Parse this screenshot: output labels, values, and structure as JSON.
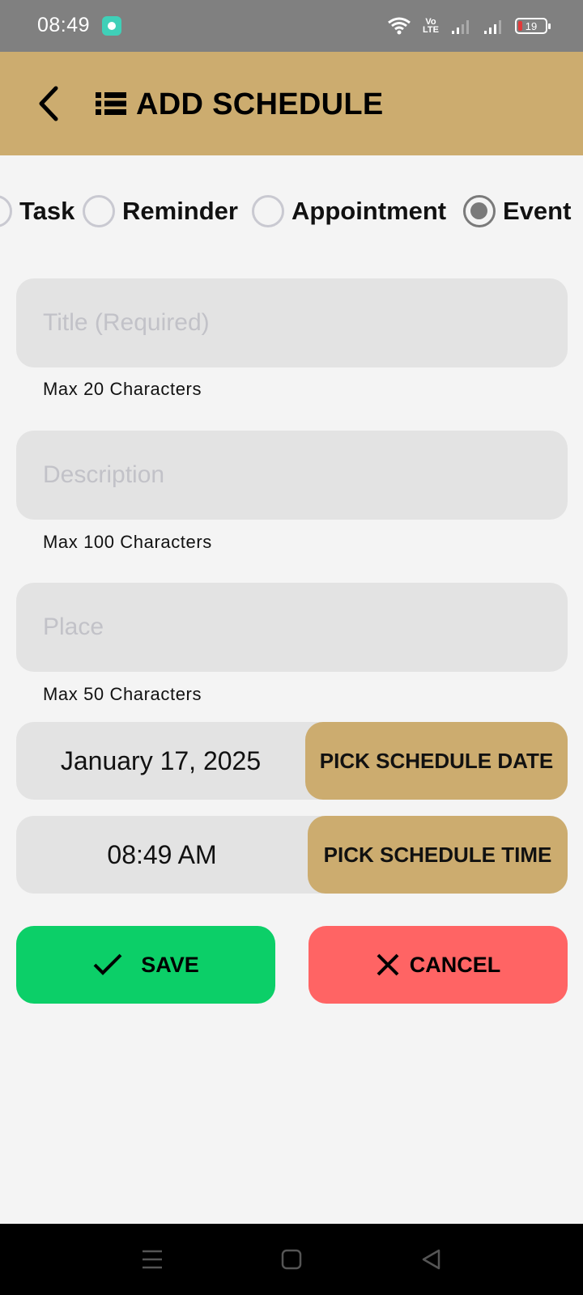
{
  "status_bar": {
    "time": "08:49",
    "network_label": "Vo LTE",
    "battery_level": "19"
  },
  "header": {
    "title": "ADD SCHEDULE"
  },
  "schedule_types": {
    "options": [
      "Task",
      "Reminder",
      "Appointment",
      "Event"
    ],
    "selected": "Event"
  },
  "form": {
    "title": {
      "placeholder": "Title (Required)",
      "value": "",
      "hint": "Max 20 Characters"
    },
    "description": {
      "placeholder": "Description",
      "value": "",
      "hint": "Max 100 Characters"
    },
    "place": {
      "placeholder": "Place",
      "value": "",
      "hint": "Max 50 Characters"
    }
  },
  "date_picker": {
    "value": "January 17, 2025",
    "button_label": "PICK SCHEDULE DATE"
  },
  "time_picker": {
    "value": "08:49 AM",
    "button_label": "PICK SCHEDULE TIME"
  },
  "actions": {
    "save_label": "SAVE",
    "cancel_label": "CANCEL"
  },
  "colors": {
    "accent": "#ccac6f",
    "save": "#0ccf68",
    "cancel": "#ff6464",
    "status_bar": "#808080",
    "field_bg": "#e3e3e3"
  },
  "icons": {
    "back": "chevron-left-icon",
    "title": "list-icon",
    "save": "check-icon",
    "cancel": "close-icon"
  }
}
